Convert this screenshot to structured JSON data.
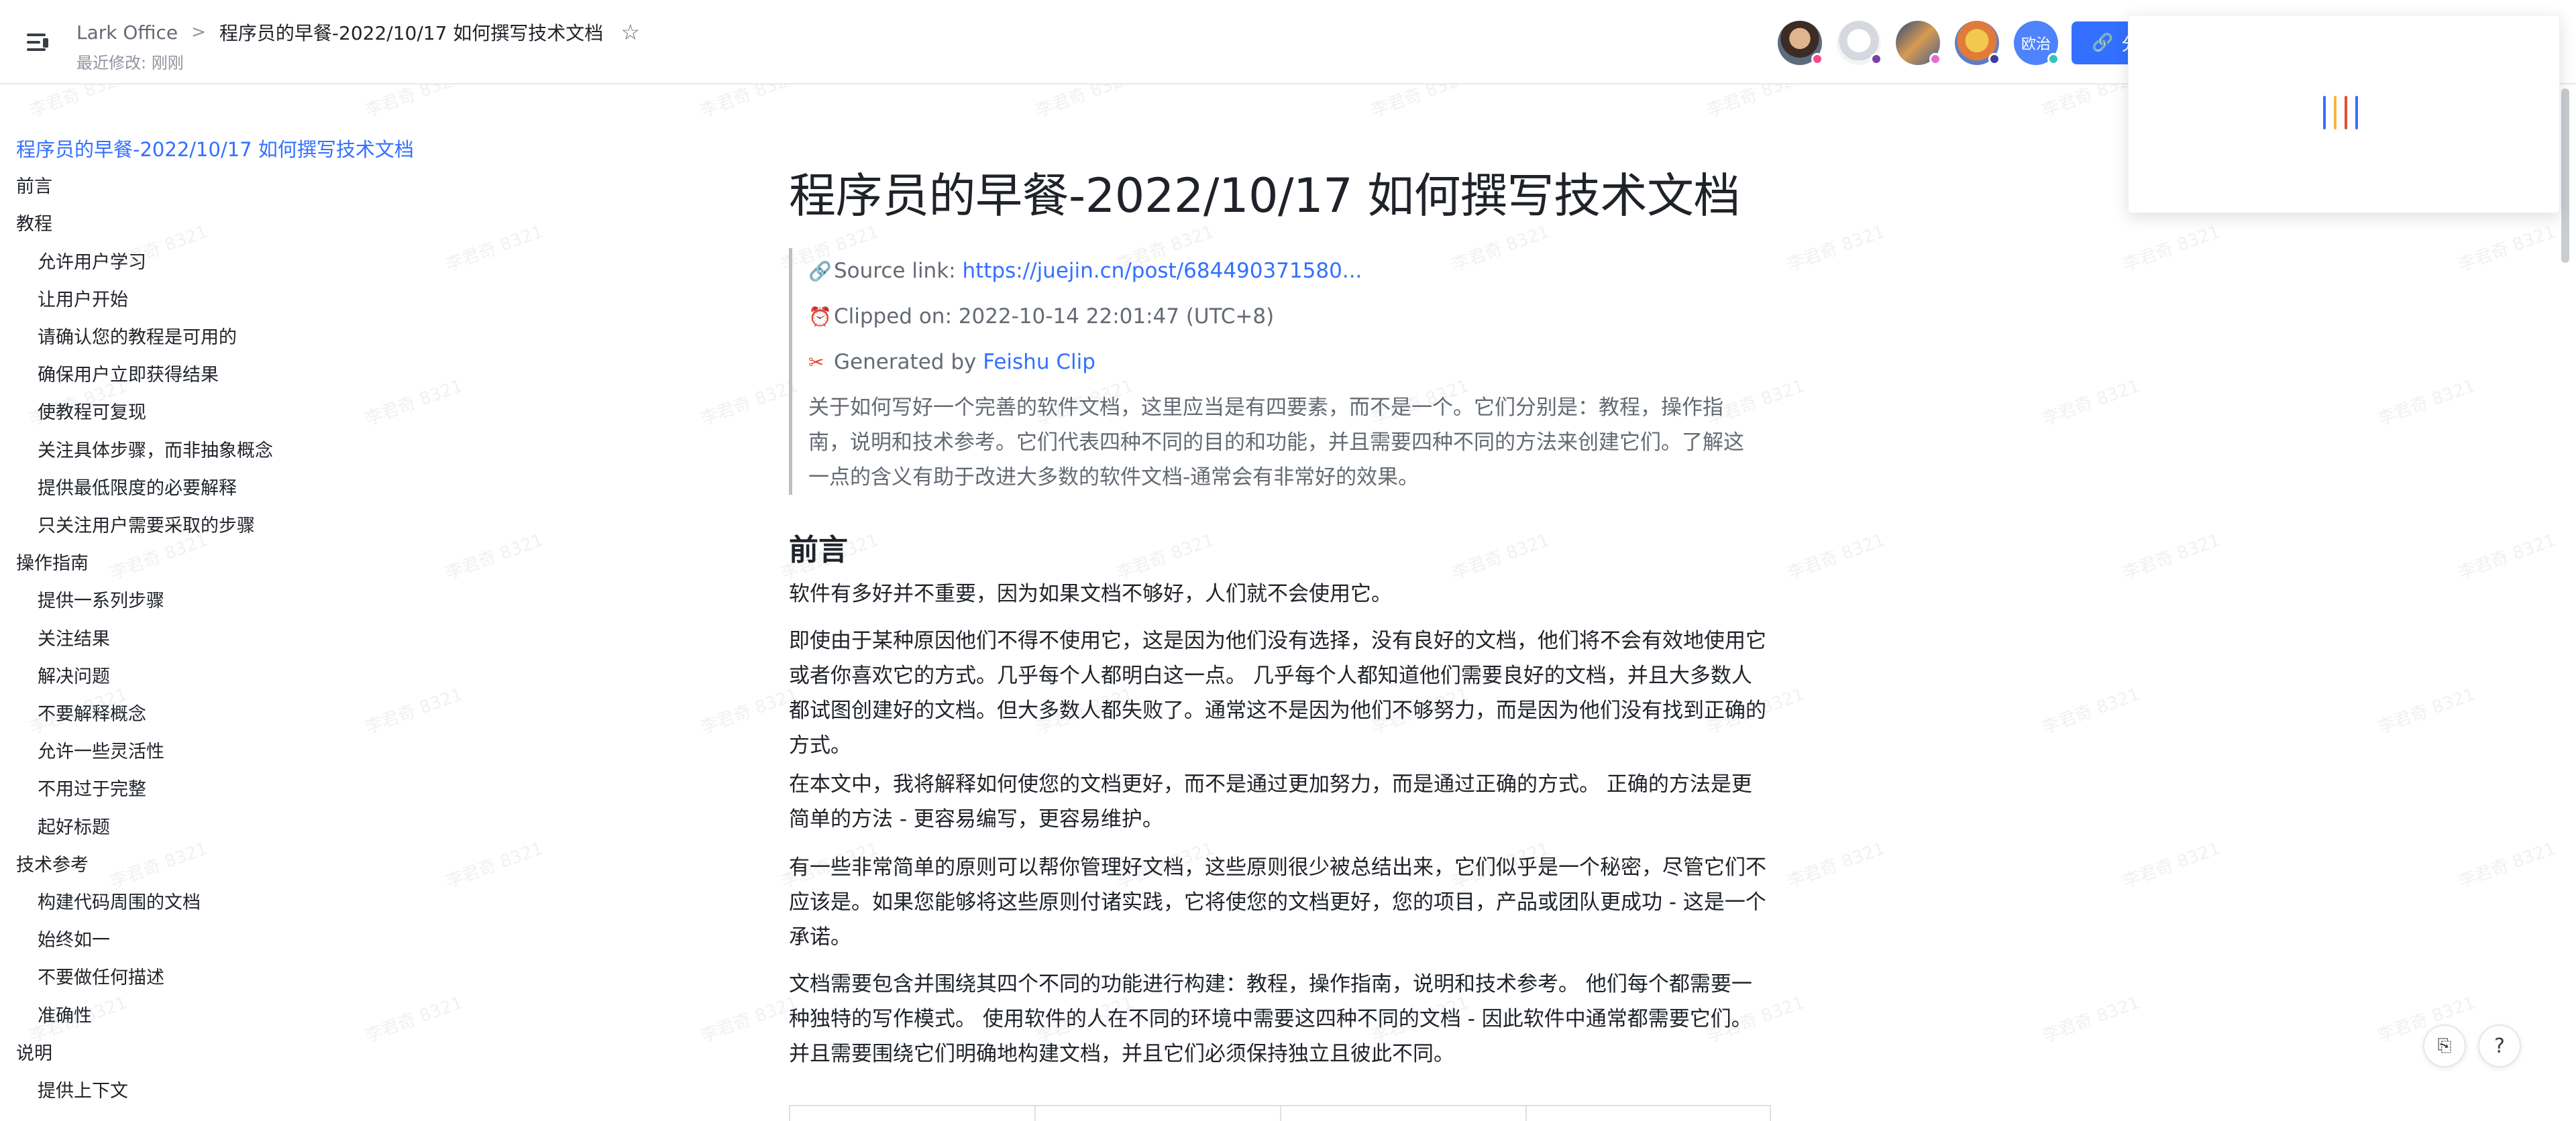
{
  "header": {
    "breadcrumb_root": "Lark Office",
    "breadcrumb_separator": ">",
    "doc_title": "程序员的早餐-2022/10/17 如何撰写技术文档",
    "last_modified": "最近修改: 刚刚",
    "share_label": "分",
    "avatar_initials": "欧治",
    "icons": [
      "menu-toggle-icon",
      "star-icon",
      "link-icon"
    ]
  },
  "outline": {
    "items": [
      {
        "label": "程序员的早餐-2022/10/17 如何撰写技术文档",
        "level": 0
      },
      {
        "label": "前言",
        "level": 1
      },
      {
        "label": "教程",
        "level": 1
      },
      {
        "label": "允许用户学习",
        "level": 2
      },
      {
        "label": "让用户开始",
        "level": 2
      },
      {
        "label": "请确认您的教程是可用的",
        "level": 2
      },
      {
        "label": "确保用户立即获得结果",
        "level": 2
      },
      {
        "label": "使教程可复现",
        "level": 2
      },
      {
        "label": "关注具体步骤，而非抽象概念",
        "level": 2
      },
      {
        "label": "提供最低限度的必要解释",
        "level": 2
      },
      {
        "label": "只关注用户需要采取的步骤",
        "level": 2
      },
      {
        "label": "操作指南",
        "level": 1
      },
      {
        "label": "提供一系列步骤",
        "level": 2
      },
      {
        "label": "关注结果",
        "level": 2
      },
      {
        "label": "解决问题",
        "level": 2
      },
      {
        "label": "不要解释概念",
        "level": 2
      },
      {
        "label": "允许一些灵活性",
        "level": 2
      },
      {
        "label": "不用过于完整",
        "level": 2
      },
      {
        "label": "起好标题",
        "level": 2
      },
      {
        "label": "技术参考",
        "level": 1
      },
      {
        "label": "构建代码周围的文档",
        "level": 2
      },
      {
        "label": "始终如一",
        "level": 2
      },
      {
        "label": "不要做任何描述",
        "level": 2
      },
      {
        "label": "准确性",
        "level": 2
      },
      {
        "label": "说明",
        "level": 1
      },
      {
        "label": "提供上下文",
        "level": 2
      }
    ]
  },
  "document": {
    "title": "程序员的早餐-2022/10/17 如何撰写技术文档",
    "source_label": "Source link: ",
    "source_link": "https://juejin.cn/post/684490371580...",
    "clipped_on": "Clipped on: 2022-10-14 22:01:47 (UTC+8)",
    "generated_by_label": "Generated by ",
    "generated_by_link": "Feishu Clip",
    "quote_body": "关于如何写好一个完善的软件文档，这里应当是有四要素，而不是一个。它们分别是：教程，操作指南，说明和技术参考。它们代表四种不同的目的和功能，并且需要四种不同的方法来创建它们。了解这一点的含义有助于改进大多数的软件文档-通常会有非常好的效果。",
    "section_heading": "前言",
    "paragraphs": [
      "软件有多好并不重要，因为如果文档不够好，人们就不会使用它。",
      "即使由于某种原因他们不得不使用它，这是因为他们没有选择，没有良好的文档，他们将不会有效地使用它或者你喜欢它的方式。几乎每个人都明白这一点。 几乎每个人都知道他们需要良好的文档，并且大多数人都试图创建好的文档。但大多数人都失败了。通常这不是因为他们不够努力，而是因为他们没有找到正确的方式。",
      "在本文中，我将解释如何使您的文档更好，而不是通过更加努力，而是通过正确的方式。 正确的方法是更简单的方法 - 更容易编写，更容易维护。",
      "有一些非常简单的原则可以帮你管理好文档，这些原则很少被总结出来，它们似乎是一个秘密，尽管它们不应该是。如果您能够将这些原则付诸实践，它将使您的文档更好，您的项目，产品或团队更成功 - 这是一个承诺。",
      "文档需要包含并围绕其四个不同的功能进行构建：教程，操作指南，说明和技术参考。 他们每个都需要一种独特的写作模式。 使用软件的人在不同的环境中需要这四种不同的文档 - 因此软件中通常都需要它们。并且需要围绕它们明确地构建文档，并且它们必须保持独立且彼此不同。"
    ]
  },
  "watermark_text": "李君奇 8321",
  "colors": {
    "accent": "#3370ff",
    "text": "#1f2329",
    "muted": "#646a73"
  }
}
